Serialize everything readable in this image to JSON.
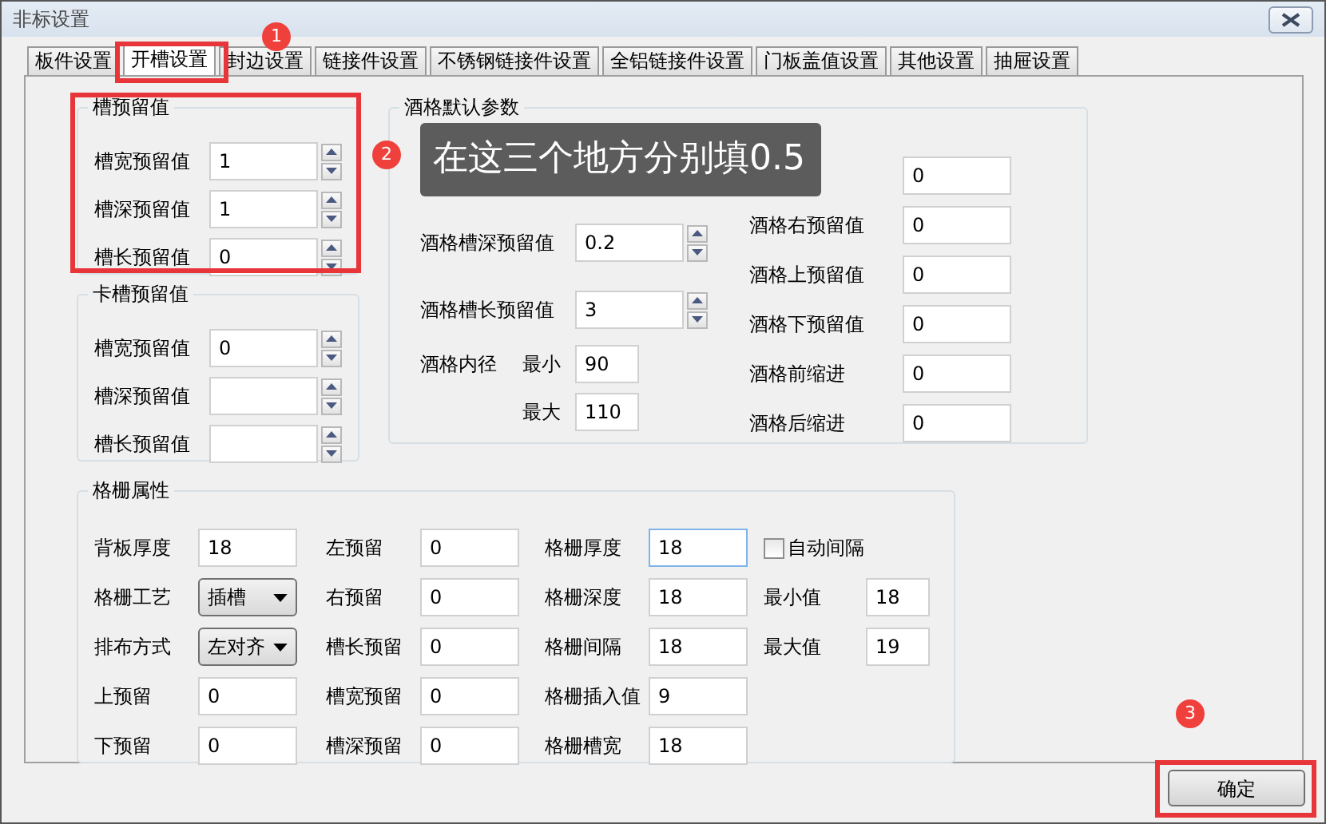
{
  "window": {
    "title": "非标设置"
  },
  "tabs": [
    {
      "label": "板件设置",
      "selected": false
    },
    {
      "label": "开槽设置",
      "selected": true
    },
    {
      "label": "封边设置",
      "selected": false
    },
    {
      "label": "链接件设置",
      "selected": false
    },
    {
      "label": "不锈钢链接件设置",
      "selected": false
    },
    {
      "label": "全铝链接件设置",
      "selected": false
    },
    {
      "label": "门板盖值设置",
      "selected": false
    },
    {
      "label": "其他设置",
      "selected": false
    },
    {
      "label": "抽屉设置",
      "selected": false
    }
  ],
  "slot_reserve": {
    "title": "槽预留值",
    "fields": [
      {
        "label": "槽宽预留值",
        "value": "1"
      },
      {
        "label": "槽深预留值",
        "value": "1"
      },
      {
        "label": "槽长预留值",
        "value": "0"
      }
    ]
  },
  "card_slot_reserve": {
    "title": "卡槽预留值",
    "fields": [
      {
        "label": "槽宽预留值",
        "value": "0"
      },
      {
        "label": "槽深预留值"
      },
      {
        "label": "槽长预留值"
      }
    ]
  },
  "wine_rack_defaults": {
    "title": "酒格默认参数",
    "left_fields": [
      {
        "kind": "covered"
      },
      {
        "kind": "spinner",
        "label": "酒格槽深预留值",
        "value": "0.2"
      },
      {
        "kind": "spinner",
        "label": "酒格槽长预留值",
        "value": "3"
      }
    ],
    "inner_diameter": {
      "label": "酒格内径",
      "min_label": "最小",
      "min_value": "90",
      "max_label": "最大",
      "max_value": "110"
    },
    "right_fields": [
      {
        "value": "0"
      },
      {
        "label": "酒格右预留值",
        "value": "0"
      },
      {
        "label": "酒格上预留值",
        "value": "0"
      },
      {
        "label": "酒格下预留值",
        "value": "0"
      },
      {
        "label": "酒格前缩进",
        "value": "0"
      },
      {
        "label": "酒格后缩进",
        "value": "0"
      }
    ]
  },
  "grille_properties": {
    "title": "格栅属性",
    "rows": [
      [
        {
          "kind": "text",
          "label": "背板厚度",
          "value": "18"
        },
        {
          "kind": "text",
          "label": "左预留",
          "value": "0"
        },
        {
          "kind": "text",
          "label": "格栅厚度",
          "value": "18",
          "focused": true
        },
        {
          "kind": "checkbox",
          "label": "自动间隔",
          "checked": false
        }
      ],
      [
        {
          "kind": "dropdown",
          "label": "格栅工艺",
          "value": "插槽"
        },
        {
          "kind": "text",
          "label": "右预留",
          "value": "0"
        },
        {
          "kind": "text",
          "label": "格栅深度",
          "value": "18"
        },
        {
          "kind": "text",
          "label": "最小值",
          "value": "18"
        }
      ],
      [
        {
          "kind": "dropdown",
          "label": "排布方式",
          "value": "左对齐"
        },
        {
          "kind": "text",
          "label": "槽长预留",
          "value": "0"
        },
        {
          "kind": "text",
          "label": "格栅间隔",
          "value": "18"
        },
        {
          "kind": "text",
          "label": "最大值",
          "value": "19"
        }
      ],
      [
        {
          "kind": "text",
          "label": "上预留",
          "value": "0"
        },
        {
          "kind": "text",
          "label": "槽宽预留",
          "value": "0"
        },
        {
          "kind": "text",
          "label": "格栅插入值",
          "value": "9"
        }
      ],
      [
        {
          "kind": "text",
          "label": "下预留",
          "value": "0"
        },
        {
          "kind": "text",
          "label": "槽深预留",
          "value": "0"
        },
        {
          "kind": "text",
          "label": "格栅槽宽",
          "value": "18"
        }
      ]
    ]
  },
  "confirm_button": "确定",
  "annotations": {
    "markers": [
      "1",
      "2",
      "3"
    ],
    "tooltip": "在这三个地方分别填0.5"
  }
}
